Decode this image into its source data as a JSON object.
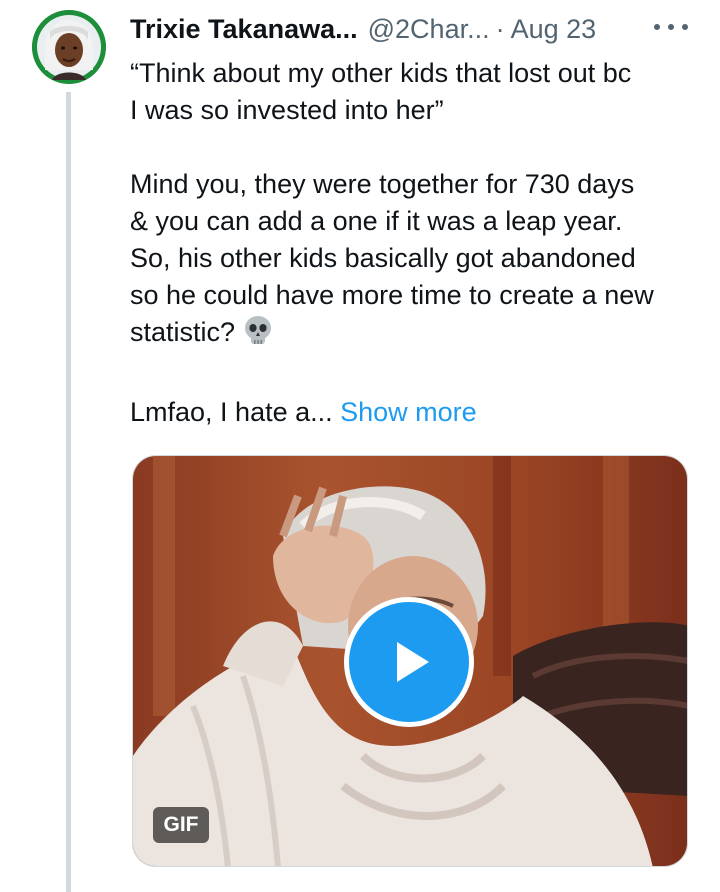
{
  "author": {
    "display_name": "Trixie Takanawa...",
    "handle": "@2Char...",
    "separator": "·",
    "date": "Aug 23"
  },
  "tweet": {
    "paragraph_1_line_1": "“Think about my other kids that lost out bc",
    "paragraph_1_line_2": "I was so invested into her”",
    "paragraph_2_line_1": "Mind you, they were together for 730 days",
    "paragraph_2_line_2": "& you can add a one if it was a leap year.",
    "paragraph_2_line_3": "So, his other kids basically got abandoned",
    "paragraph_2_line_4": "so he could have more time to create a new",
    "paragraph_2_line_5": "statistic?",
    "paragraph_3_text": "Lmfao, I hate a... ",
    "show_more_label": "Show more"
  },
  "media": {
    "badge": "GIF"
  },
  "icons": {
    "more": "more-horizontal-icon",
    "skull": "skull-emoji-icon",
    "play": "play-icon"
  },
  "colors": {
    "link": "#1d9bf0",
    "secondary_text": "#536471",
    "avatar_ring": "#1d8f3a",
    "thread_line": "#cfd9de"
  }
}
